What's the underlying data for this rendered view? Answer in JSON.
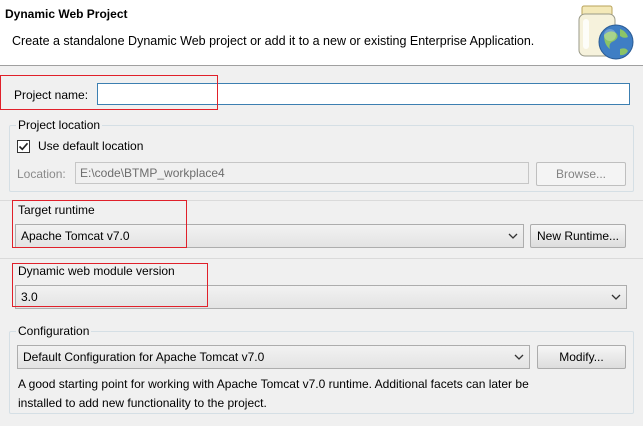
{
  "header": {
    "title": "Dynamic Web Project",
    "description": "Create a standalone Dynamic Web project or add it to a new or existing Enterprise Application.",
    "icon": "wizard-banner-jar-globe-icon"
  },
  "project_name": {
    "label": "Project name:",
    "value": ""
  },
  "project_location": {
    "legend": "Project location",
    "use_default_label": "Use default location",
    "use_default_checked": true,
    "location_label": "Location:",
    "location_value": "E:\\code\\BTMP_workplace4",
    "browse_label": "Browse..."
  },
  "target_runtime": {
    "legend": "Target runtime",
    "selected": "Apache Tomcat v7.0",
    "new_runtime_label": "New Runtime..."
  },
  "module_version": {
    "legend": "Dynamic web module version",
    "selected": "3.0"
  },
  "configuration": {
    "legend": "Configuration",
    "selected": "Default Configuration for Apache Tomcat v7.0",
    "modify_label": "Modify...",
    "description_line1": "A good starting point for working with Apache Tomcat v7.0 runtime. Additional facets can later be",
    "description_line2": "installed to add new functionality to the project."
  },
  "colors": {
    "highlight": "#e0202a",
    "focus_border": "#3c7fb1"
  }
}
